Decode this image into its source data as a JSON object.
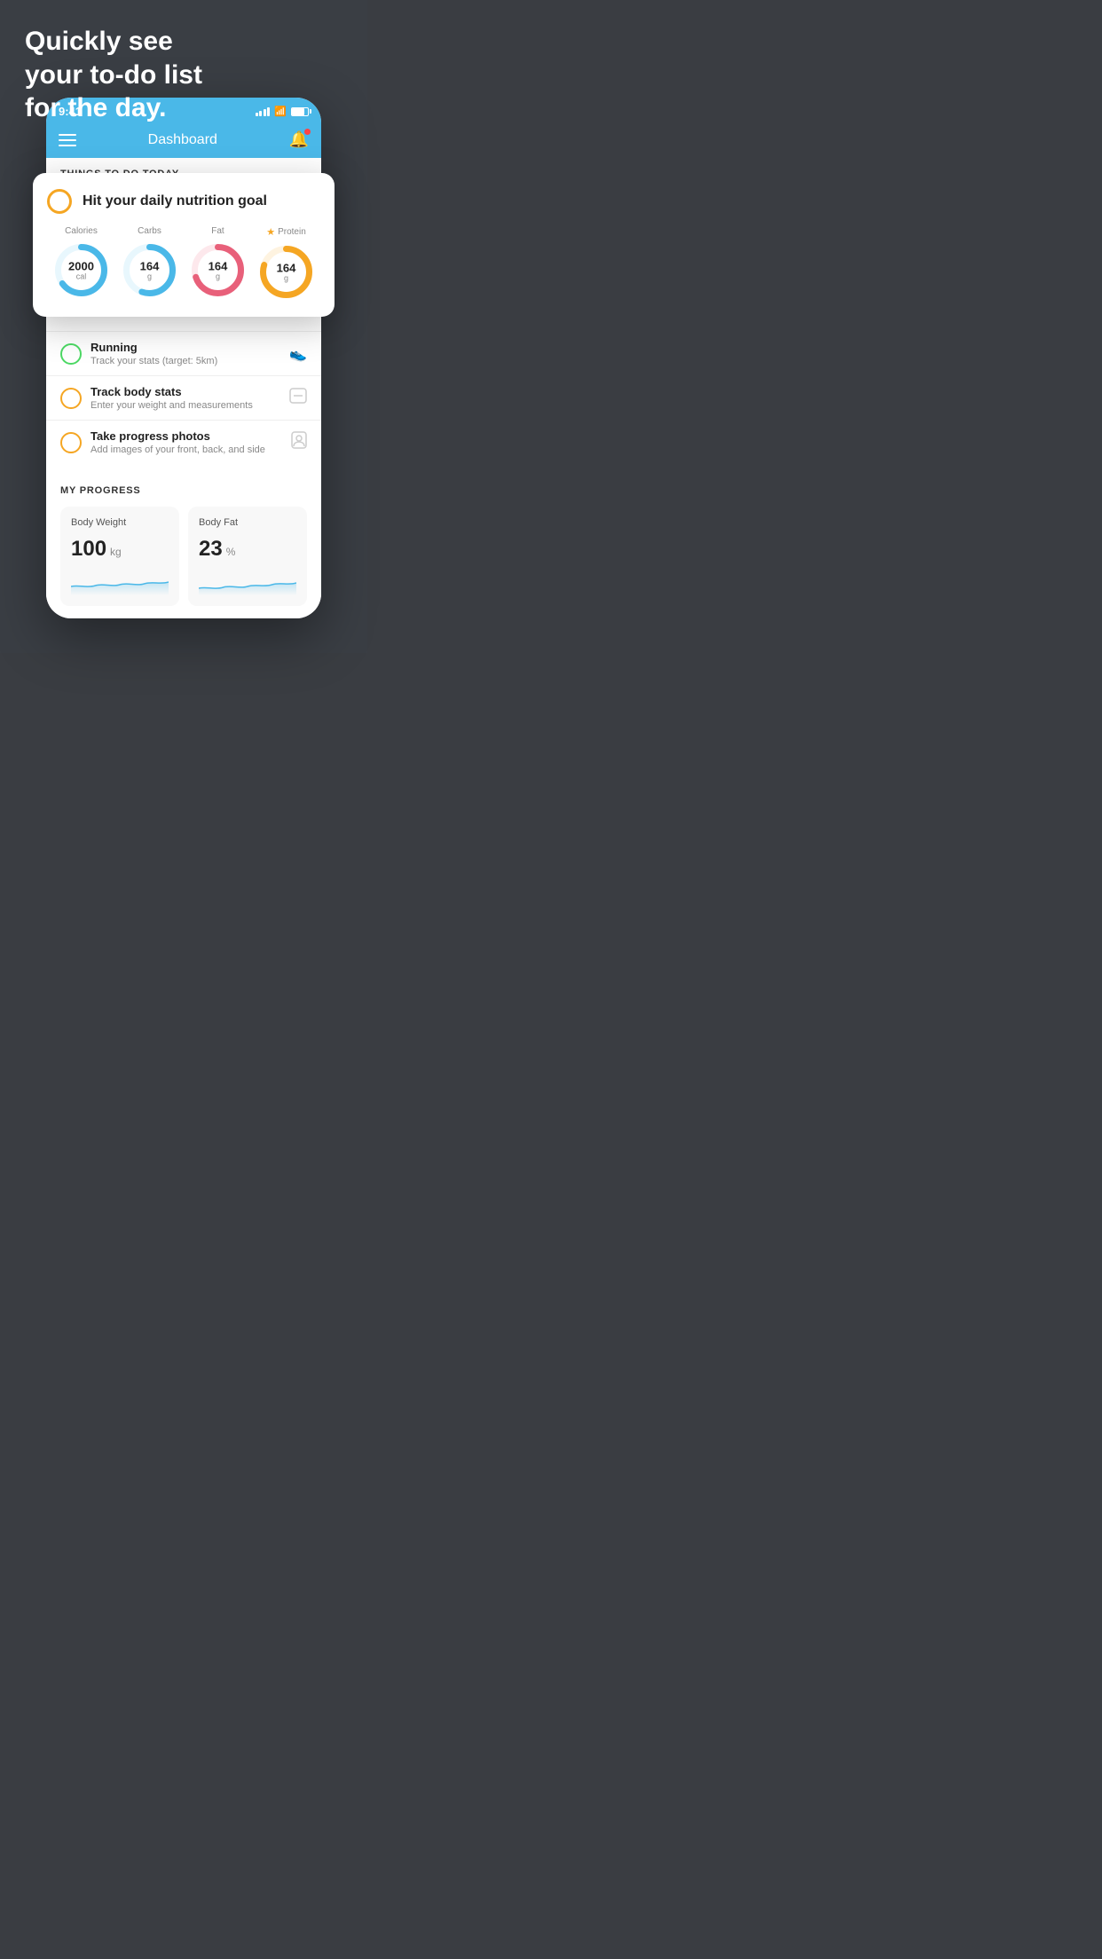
{
  "background_color": "#3a3e44",
  "headline": {
    "line1": "Quickly see",
    "line2": "your to-do list",
    "line3": "for the day."
  },
  "status_bar": {
    "time": "9:41"
  },
  "app_header": {
    "title": "Dashboard"
  },
  "sections": {
    "things_to_do": {
      "title": "THINGS TO DO TODAY"
    }
  },
  "floating_card": {
    "check_label": "Hit your daily nutrition goal",
    "nutrition": [
      {
        "label": "Calories",
        "value": "2000",
        "unit": "cal",
        "color": "#4ab8e8",
        "track_pct": 65
      },
      {
        "label": "Carbs",
        "value": "164",
        "unit": "g",
        "color": "#4ab8e8",
        "track_pct": 55
      },
      {
        "label": "Fat",
        "value": "164",
        "unit": "g",
        "color": "#e8607a",
        "track_pct": 70
      },
      {
        "label": "Protein",
        "value": "164",
        "unit": "g",
        "color": "#f5a623",
        "track_pct": 80,
        "star": true
      }
    ]
  },
  "todo_items": [
    {
      "id": "running",
      "circle_color": "green",
      "main": "Running",
      "sub": "Track your stats (target: 5km)",
      "icon": "👟"
    },
    {
      "id": "body-stats",
      "circle_color": "yellow",
      "main": "Track body stats",
      "sub": "Enter your weight and measurements",
      "icon": "⊡"
    },
    {
      "id": "progress-photos",
      "circle_color": "yellow",
      "main": "Take progress photos",
      "sub": "Add images of your front, back, and side",
      "icon": "👤"
    }
  ],
  "progress": {
    "title": "MY PROGRESS",
    "cards": [
      {
        "id": "body-weight",
        "title": "Body Weight",
        "value": "100",
        "unit": "kg"
      },
      {
        "id": "body-fat",
        "title": "Body Fat",
        "value": "23",
        "unit": "%"
      }
    ]
  }
}
